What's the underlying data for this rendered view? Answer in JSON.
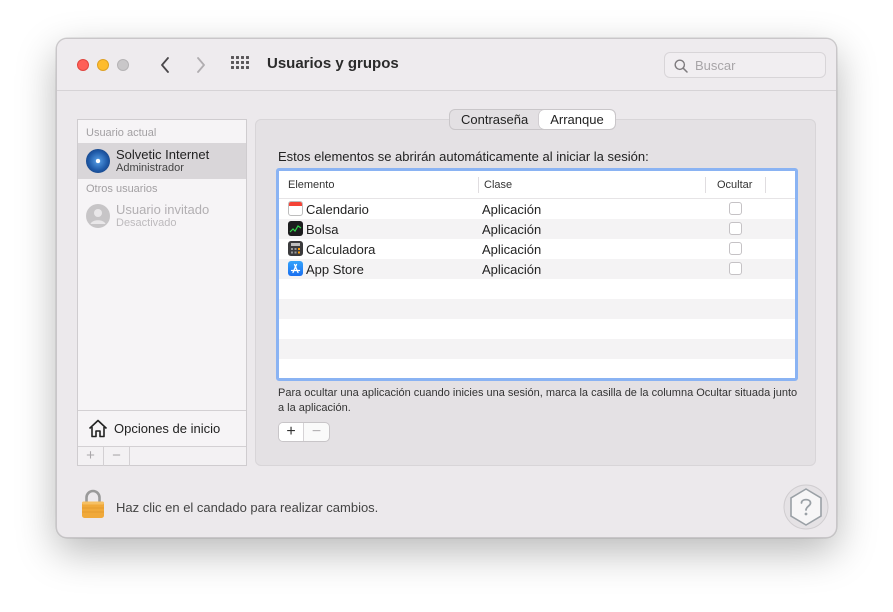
{
  "window": {
    "title": "Usuarios y grupos"
  },
  "search": {
    "placeholder": "Buscar"
  },
  "sidebar": {
    "current_user_header": "Usuario actual",
    "current_user": {
      "name": "Solvetic Internet",
      "role": "Administrador"
    },
    "other_users_header": "Otros usuarios",
    "guest_user": {
      "name": "Usuario invitado",
      "role": "Desactivado"
    },
    "login_options_label": "Opciones de inicio",
    "add_label": "+",
    "remove_label": "−"
  },
  "tabs": [
    {
      "label": "Contraseña",
      "active": false
    },
    {
      "label": "Arranque",
      "active": true
    }
  ],
  "intro_text": "Estos elementos se abrirán automáticamente al iniciar la sesión:",
  "table": {
    "columns": [
      "Elemento",
      "Clase",
      "Ocultar"
    ],
    "rows": [
      {
        "icon": "calendar-icon",
        "element": "Calendario",
        "class": "Aplicación",
        "hidden": false
      },
      {
        "icon": "stocks-icon",
        "element": "Bolsa",
        "class": "Aplicación",
        "hidden": false
      },
      {
        "icon": "calculator-icon",
        "element": "Calculadora",
        "class": "Aplicación",
        "hidden": false
      },
      {
        "icon": "app-store-icon",
        "element": "App Store",
        "class": "Aplicación",
        "hidden": false
      }
    ]
  },
  "help_text": "Para ocultar una aplicación cuando inicies una sesión, marca la casilla de la columna Ocultar situada junto a la aplicación.",
  "add_button": "+",
  "remove_button": "−",
  "lock_text": "Haz clic en el candado para realizar cambios.",
  "colors": {
    "close": "#fe5f57",
    "minimize": "#febc2e",
    "zoom_disabled": "#c9c7c9",
    "focus_ring": "#8ab3f3",
    "lock": "#f0a93a"
  }
}
